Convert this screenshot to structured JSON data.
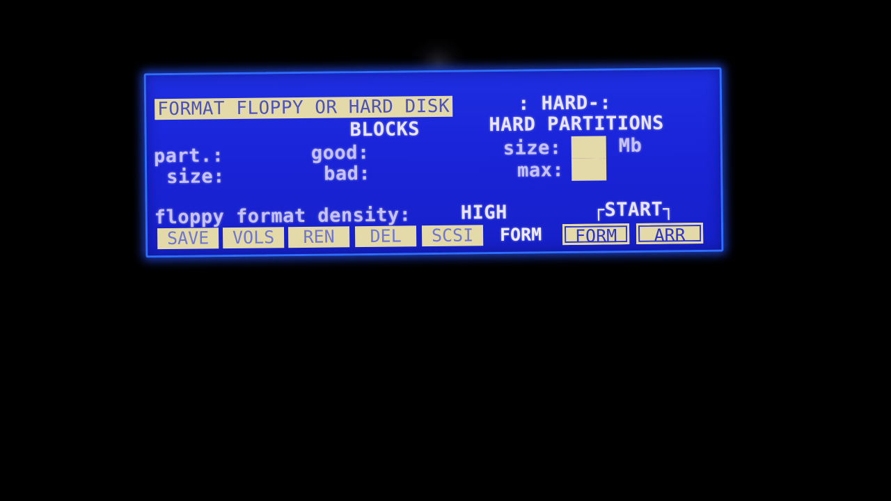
{
  "screen": {
    "title": "FORMAT FLOPPY OR HARD DISK",
    "hard_label": ": HARD-:",
    "blocks_heading": "BLOCKS",
    "partitions_heading": "HARD PARTITIONS",
    "part_label": "part.:",
    "size_label": "size:",
    "good_label": "good:",
    "bad_label": "bad:",
    "hard_size_label": "size:",
    "hard_max_label": "max:",
    "unit_label": "Mb",
    "density_label": "floppy format density:",
    "density_value": "HIGH",
    "start_label": "┌START┐"
  },
  "softkeys": [
    {
      "label": "SAVE"
    },
    {
      "label": "VOLS"
    },
    {
      "label": "REN"
    },
    {
      "label": "DEL"
    },
    {
      "label": "SCSI"
    },
    {
      "label": "FORM"
    },
    {
      "label": "FORM"
    },
    {
      "label": "ARR"
    }
  ],
  "colors": {
    "lcd_background": "#1e2ee0",
    "lcd_text": "#e8e3ff",
    "inverse_highlight": "#e4d9a8",
    "bezel_glow": "#2f6dff"
  }
}
